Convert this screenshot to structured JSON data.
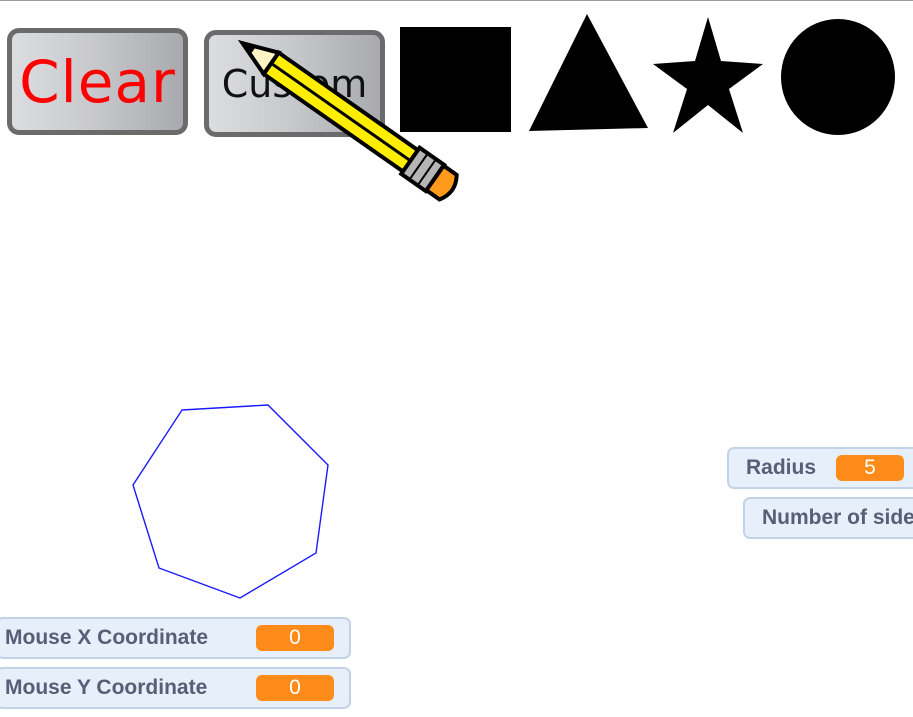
{
  "toolbar": {
    "clear_label": "Clear",
    "custom_label": "Custom"
  },
  "shapes": [
    "square",
    "triangle",
    "star",
    "circle"
  ],
  "monitors": {
    "radius": {
      "label": "Radius",
      "value": "5"
    },
    "sides": {
      "label": "Number of sides"
    },
    "mouse_x": {
      "label": "Mouse X Coordinate",
      "value": "0"
    },
    "mouse_y": {
      "label": "Mouse Y Coordinate",
      "value": "0"
    }
  },
  "drawing": {
    "polygon_sides": 7,
    "stroke_color": "#1a1aff"
  },
  "colors": {
    "accent": "#ff8c1a",
    "pencil_body": "#ffee00",
    "eraser": "#ff9a1a"
  }
}
